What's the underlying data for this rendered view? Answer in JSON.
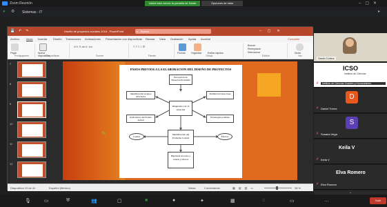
{
  "zoom": {
    "app_name": "Zoom Reunión",
    "share_notice": "Usted está viendo la pantalla de Sarah Cortez",
    "stop_label": "Opciones de vista"
  },
  "remote": {
    "tab_title": "Sistemas - IT"
  },
  "ppt": {
    "title": "Diseño de proyectos sociales 2018 - PowerPoint",
    "search_placeholder": "Buscar",
    "menu": [
      "Archivo",
      "Inicio",
      "Insertar",
      "Diseño",
      "Transiciones",
      "Animaciones",
      "Presentación con diapositivas",
      "Revisar",
      "Vista",
      "Grabación",
      "Ayuda",
      "Acrobat"
    ],
    "share_label": "Compartir",
    "ribbon_groups": [
      "Portapapeles",
      "Diapositivas",
      "Fuente",
      "Párrafo",
      "Dibujo",
      "Edición",
      "Voz"
    ],
    "ribbon_buttons": {
      "paste": "Pegar",
      "new_slide": "Nueva diapositiva",
      "shapes": "Formas",
      "arrange": "Organizar",
      "quick_styles": "Estilos rápidos",
      "find": "Buscar",
      "replace": "Reemplazar",
      "select": "Seleccionar",
      "dictate": "Dictar"
    },
    "slide_numbers": [
      "7",
      "8",
      "9",
      "10",
      "11",
      "12"
    ],
    "status_left": "Diapositiva 10 de 42",
    "status_lang": "Español (México)",
    "status_notes": "Notas",
    "status_comments": "Comentarios",
    "zoom_level": "38 %"
  },
  "slide": {
    "title": "PASOS PREVIOS A LA ELABORACION DEL DISEÑO DE PROYECTOS",
    "nodes": {
      "percepcion": "Percepción de Situación Problema",
      "identificacion": "Identificación Grupos Afectados",
      "definicion": "Definición Línea base",
      "diagnostico": "Diagnóstico de la situación",
      "indicadores": "Indicadores del Estado Actual",
      "estrategias": "Estrategias posibles",
      "identificacion2": "Identificación del Problema Central",
      "causas": "Causas",
      "efectos": "Efectos",
      "hipotesis": "Hipótesis en torno a causas y efectos"
    }
  },
  "participants": [
    {
      "name": "Sarah Cortez"
    },
    {
      "name": "Instituto de Ciencias Sociales y Humanidades",
      "logo": "ICSO"
    },
    {
      "name": "Daniel Torres",
      "initial": "D",
      "color": "#e8571e"
    },
    {
      "name": "Susana Vega",
      "initial": "S",
      "color": "#5b3fb3"
    },
    {
      "name": "Keila V",
      "big": "Keila V"
    },
    {
      "name": "Elva Romero",
      "big": "Elva Romero"
    }
  ],
  "bottom": {
    "leave": "Salir",
    "icons": [
      "mic-icon",
      "video-icon",
      "security-icon",
      "participants-icon",
      "chat-icon",
      "share-icon",
      "record-icon",
      "reactions-icon",
      "apps-icon",
      "whiteboard-icon",
      "notes-icon",
      "more-icon"
    ]
  },
  "colors": {
    "ppt_accent": "#b7472a",
    "slide_orange": "#e06a1f",
    "share_green": "#2d8a2d",
    "leave_red": "#c0392b"
  }
}
